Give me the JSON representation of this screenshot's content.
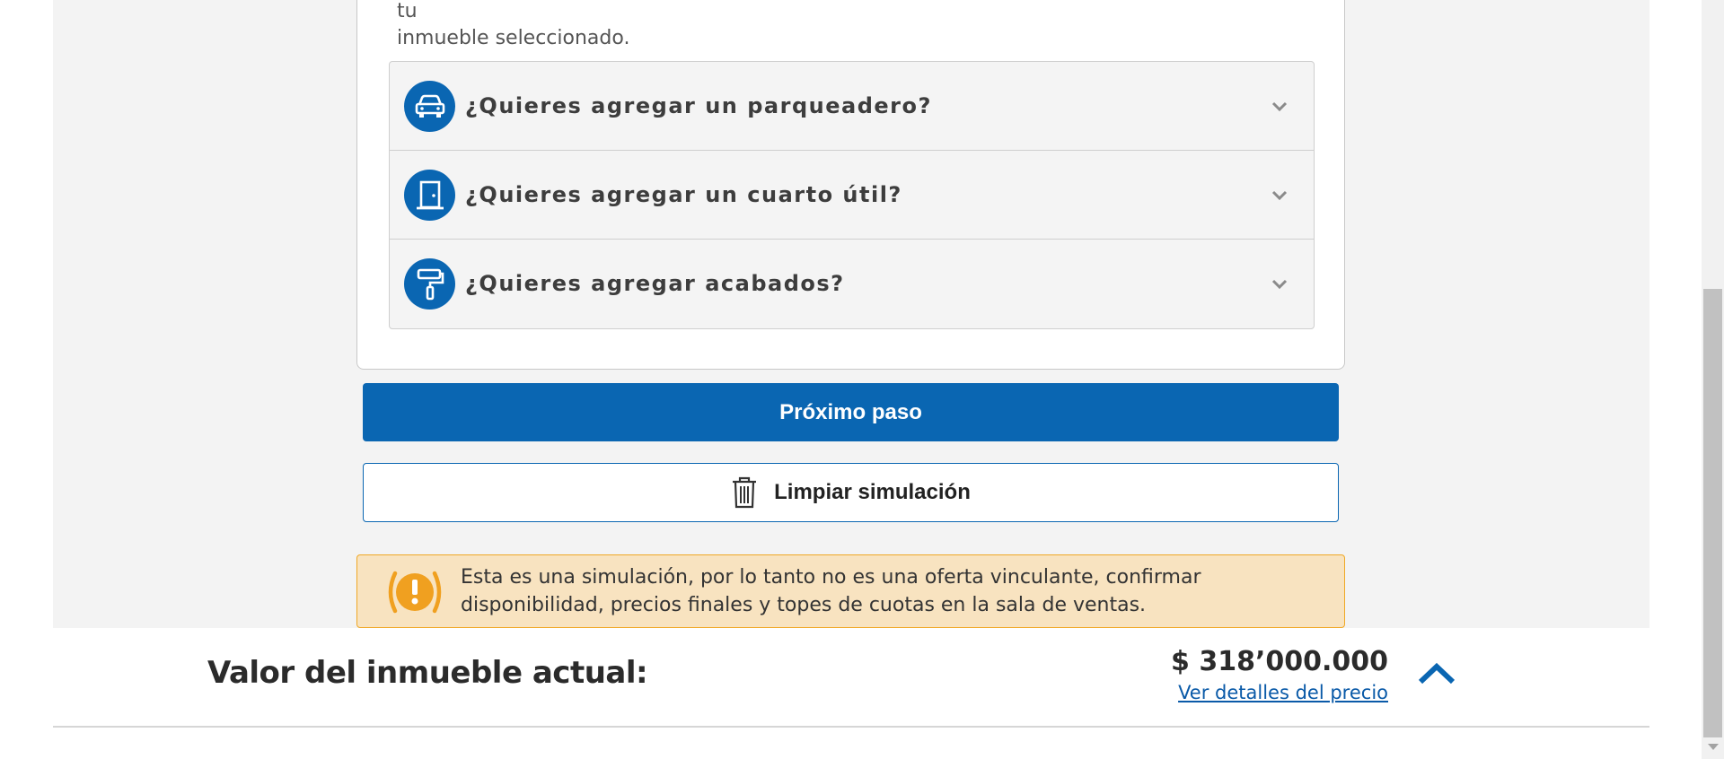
{
  "card": {
    "note_line1": "Recuerda que al agregar parqueadero, cuarto útil y acabados esto aumentará el valor de tu",
    "note_line2": "inmueble seleccionado."
  },
  "accordion": {
    "items": [
      {
        "label": "¿Quieres agregar un parqueadero?",
        "icon": "car-icon"
      },
      {
        "label": "¿Quieres agregar un cuarto útil?",
        "icon": "door-icon"
      },
      {
        "label": "¿Quieres agregar acabados?",
        "icon": "paint-roller-icon"
      }
    ]
  },
  "actions": {
    "next_label": "Próximo paso",
    "clear_label": "Limpiar simulación"
  },
  "alert": {
    "line1": "Esta es una simulación, por lo tanto no es una oferta vinculante, confirmar",
    "line2": "disponibilidad, precios finales y topes de cuotas en la sala de ventas."
  },
  "footer": {
    "label": "Valor del inmueble actual:",
    "price": "$ 318’000.000",
    "details_link": "Ver detalles del precio"
  },
  "colors": {
    "primary": "#0a66b2",
    "alert_bg": "#f8e3c0",
    "alert_border": "#f0a826",
    "text_dark": "#2b2b2b"
  }
}
